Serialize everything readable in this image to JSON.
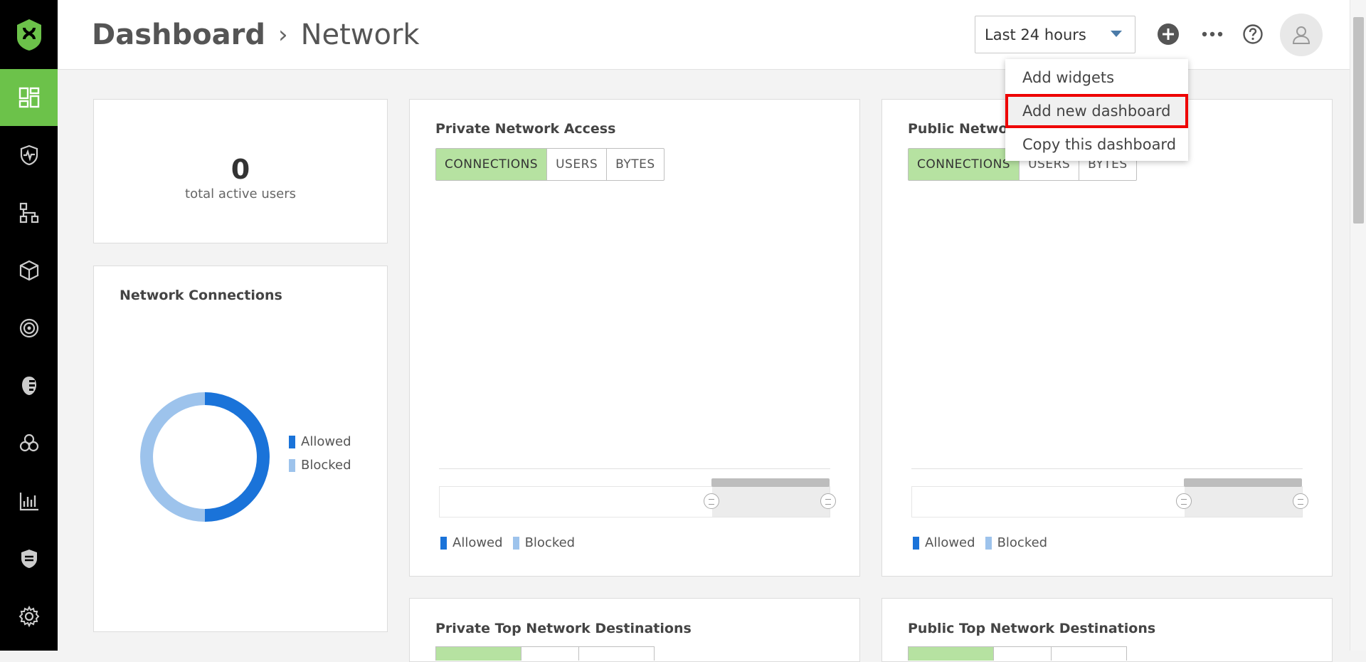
{
  "sidebar": {
    "items": [
      {
        "name": "dashboard-icon",
        "active": true
      },
      {
        "name": "shield-pulse-icon",
        "active": false
      },
      {
        "name": "network-tree-icon",
        "active": false
      },
      {
        "name": "cube-icon",
        "active": false
      },
      {
        "name": "target-icon",
        "active": false
      },
      {
        "name": "face-icon",
        "active": false
      },
      {
        "name": "biohazard-icon",
        "active": false
      },
      {
        "name": "bar-chart-icon",
        "active": false
      },
      {
        "name": "policy-shield-icon",
        "active": false
      },
      {
        "name": "gear-icon",
        "active": false
      }
    ]
  },
  "header": {
    "breadcrumb_root": "Dashboard",
    "breadcrumb_sep": "›",
    "breadcrumb_leaf": "Network",
    "time_range": "Last 24 hours"
  },
  "menu": {
    "items": [
      "Add widgets",
      "Add new dashboard",
      "Copy this dashboard"
    ]
  },
  "active_users": {
    "count": "0",
    "label": "total active users"
  },
  "network_connections": {
    "title": "Network Connections",
    "legend": [
      "Allowed",
      "Blocked"
    ]
  },
  "private_access": {
    "title": "Private Network Access",
    "tabs": [
      "CONNECTIONS",
      "USERS",
      "BYTES"
    ],
    "legend": [
      "Allowed",
      "Blocked"
    ]
  },
  "public_access": {
    "title": "Public Network",
    "tabs": [
      "CONNECTIONS",
      "USERS",
      "BYTES"
    ],
    "legend": [
      "Allowed",
      "Blocked"
    ]
  },
  "private_top": {
    "title": "Private Top Network Destinations"
  },
  "public_top": {
    "title": "Public Top Network Destinations"
  },
  "colors": {
    "brand": "#6cc24a",
    "allowed": "#1a73d9",
    "blocked": "#9dc3ec",
    "highlight": "#e00000"
  },
  "chart_data": {
    "type": "pie",
    "title": "Network Connections",
    "categories": [
      "Allowed",
      "Blocked"
    ],
    "values": [
      50,
      50
    ]
  }
}
